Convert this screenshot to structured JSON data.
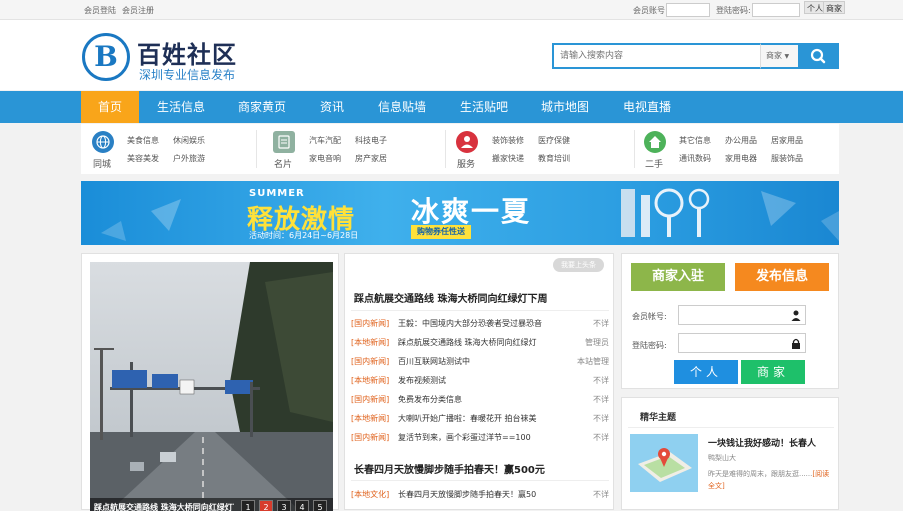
{
  "topbar": {
    "login_link": "会员登陆",
    "register_link": "会员注册",
    "account_label": "会员账号",
    "password_label": "登陆密码:",
    "personal_button": "个人",
    "merchant_button": "商家"
  },
  "header": {
    "logo_letter": "B",
    "site_name": "百姓社区",
    "slogan": "深圳专业信息发布",
    "search_placeholder": "请输入搜索内容",
    "search_type": "商家"
  },
  "nav": {
    "items": [
      "首页",
      "生活信息",
      "商家黄页",
      "资讯",
      "信息贴墙",
      "生活贴吧",
      "城市地图",
      "电视直播"
    ]
  },
  "categories": [
    {
      "name": "同城",
      "icon": "globe-icon",
      "color": "#2a80c4",
      "links": [
        "美食信息",
        "休闲娱乐",
        "美容美发",
        "户外旅游"
      ]
    },
    {
      "name": "名片",
      "icon": "card-icon",
      "color": "#8fb1a0",
      "links": [
        "汽车汽配",
        "科技电子",
        "家电音响",
        "房产家居"
      ]
    },
    {
      "name": "服务",
      "icon": "service-icon",
      "color": "#d8323e",
      "links": [
        "装饰装修",
        "医疗保健",
        "搬家快递",
        "教育培训"
      ]
    },
    {
      "name": "二手",
      "icon": "house-icon",
      "color": "#4db25a",
      "links": [
        "其它信息",
        "办公用品",
        "居家用品",
        "通讯数码",
        "家用电器",
        "服装饰品"
      ]
    }
  ],
  "banner": {
    "summer": "SUMMER",
    "headline": "释放激情",
    "cool": "冰爽一夏",
    "date_label": "活动时间：",
    "date_range": "6月24日~6月28日",
    "promo": "购物券任性送"
  },
  "slideshow": {
    "caption": "踩点航展交通路线 珠海大桥同向红绿灯下",
    "pages": [
      "1",
      "2",
      "3",
      "4",
      "5"
    ],
    "active_page": 2
  },
  "news": {
    "post_button": "我要上头条",
    "headline_1": "踩点航展交通路线 珠海大桥同向红绿灯下周",
    "headline_2": "长春四月天放慢脚步随手拍春天！赢500元",
    "rows": [
      {
        "cat": "[国内新闻]",
        "title": "王毅：中国境内大部分恐袭者受过暴恐音",
        "user": "不详"
      },
      {
        "cat": "[本地新闻]",
        "title": "踩点航展交通路线 珠海大桥同向红绿灯",
        "user": "管理员"
      },
      {
        "cat": "[国内新闻]",
        "title": "百川互联网站测试中",
        "user": "本站管理"
      },
      {
        "cat": "[本地新闻]",
        "title": "发布视频测试",
        "user": "不详"
      },
      {
        "cat": "[国内新闻]",
        "title": "免费发布分类信息",
        "user": "不详"
      },
      {
        "cat": "[本地新闻]",
        "title": "大喇叭开始广播啦：春暖花开 拍台袜美",
        "user": "不详"
      },
      {
        "cat": "[国内新闻]",
        "title": "复活节到来，画个彩蛋过洋节==100",
        "user": "不详"
      }
    ],
    "rows_2": [
      {
        "cat": "[本地文化]",
        "title": "长春四月天放慢脚步随手拍春天！赢50",
        "user": "不详"
      }
    ]
  },
  "login": {
    "merchant_join": "商家入驻",
    "post_info": "发布信息",
    "account_label": "会员帐号:",
    "password_label": "登陆密码:",
    "personal_btn": "个人",
    "merchant_btn": "商家"
  },
  "featured": {
    "title": "精华主题",
    "item_title": "一块钱让我好感动！长春人",
    "author": "鸭梨山大",
    "snippet_1": "昨天是难得的周末，跟朋友逛......",
    "snippet_more": "[阅读全文]"
  },
  "colors": {
    "primary": "#2a95d6",
    "nav_active": "#f9a51a",
    "merchant_green": "#8db64a",
    "post_orange": "#f5891f",
    "personal_blue": "#1f8fe0",
    "merchant_teal": "#1ec06a",
    "news_cat": "#e0621c"
  }
}
